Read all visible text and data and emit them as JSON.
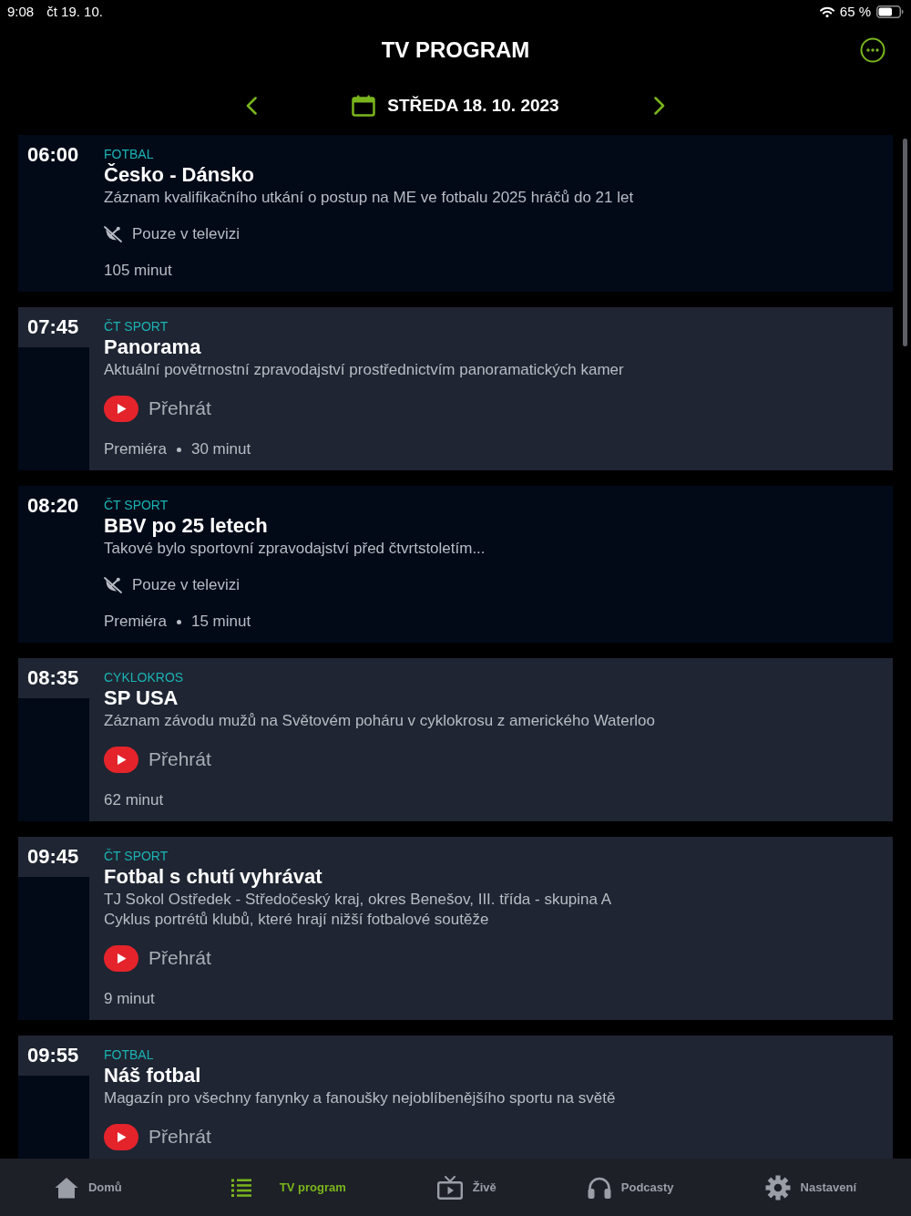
{
  "status_bar": {
    "time": "9:08",
    "date": "čt 19. 10.",
    "battery": "65 %"
  },
  "header": {
    "title": "TV PROGRAM"
  },
  "date_nav": {
    "date": "STŘEDA 18. 10. 2023"
  },
  "programs": [
    {
      "time": "06:00",
      "category": "FOTBAL",
      "title": "Česko - Dánsko",
      "description": [
        "Záznam kvalifikačního utkání o postup na ME ve fotbalu 2025 hráčů do 21 let"
      ],
      "availability": {
        "kind": "tv_only",
        "label": "Pouze v televizi"
      },
      "meta": [
        "105 minut"
      ]
    },
    {
      "time": "07:45",
      "category": "ČT SPORT",
      "title": "Panorama",
      "description": [
        "Aktuální povětrnostní zpravodajství prostřednictvím panoramatických kamer"
      ],
      "availability": {
        "kind": "play",
        "label": "Přehrát"
      },
      "meta": [
        "Premiéra",
        "30 minut"
      ]
    },
    {
      "time": "08:20",
      "category": "ČT SPORT",
      "title": "BBV po 25 letech",
      "description": [
        "Takové bylo sportovní zpravodajství před čtvrtstoletím..."
      ],
      "availability": {
        "kind": "tv_only",
        "label": "Pouze v televizi"
      },
      "meta": [
        "Premiéra",
        "15 minut"
      ]
    },
    {
      "time": "08:35",
      "category": "CYKLOKROS",
      "title": "SP USA",
      "description": [
        "Záznam závodu mužů na Světovém poháru v cyklokrosu z amerického Waterloo"
      ],
      "availability": {
        "kind": "play",
        "label": "Přehrát"
      },
      "meta": [
        "62 minut"
      ]
    },
    {
      "time": "09:45",
      "category": "ČT SPORT",
      "title": "Fotbal s chutí vyhrávat",
      "description": [
        "TJ Sokol Ostředek - Středočeský kraj, okres Benešov, III. třída - skupina A",
        "Cyklus portrétů klubů, které hrají nižší fotbalové soutěže"
      ],
      "availability": {
        "kind": "play",
        "label": "Přehrát"
      },
      "meta": [
        "9 minut"
      ]
    },
    {
      "time": "09:55",
      "category": "FOTBAL",
      "title": "Náš fotbal",
      "description": [
        "Magazín pro všechny fanynky a fanoušky nejoblíbenějšího sportu na světě"
      ],
      "availability": {
        "kind": "play",
        "label": "Přehrát"
      }
    }
  ],
  "tab_bar": {
    "items": [
      {
        "kind": "home",
        "label": "Domů",
        "selected": false
      },
      {
        "kind": "program",
        "label": "TV program",
        "selected": true
      },
      {
        "kind": "live",
        "label": "Živě",
        "selected": false
      },
      {
        "kind": "podcasts",
        "label": "Podcasty",
        "selected": false
      },
      {
        "kind": "settings",
        "label": "Nastavení",
        "selected": false
      }
    ]
  }
}
